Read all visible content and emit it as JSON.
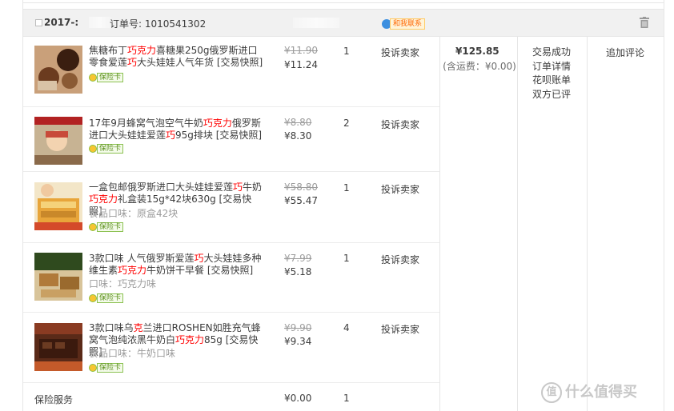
{
  "order": {
    "date": "2017-:",
    "order_no": "订单号: 1010541302",
    "contact_label": "和我联系",
    "total": "¥125.85",
    "freight": "(含运费：¥0.00)",
    "status_lines": [
      "交易成功",
      "订单详情",
      "花呗账单",
      "双方已评"
    ],
    "review_label": "追加评论"
  },
  "items": [
    {
      "title_a": "焦糖布丁",
      "title_hl1": "巧克力",
      "title_b": "喜糖果250g俄罗斯进口零食爱莲",
      "title_hl2": "巧",
      "title_c": "大头娃娃人气年货 [交易快照]",
      "option": "",
      "old_price": "¥11.90",
      "price": "¥11.24",
      "qty": "1",
      "action": "投诉卖家",
      "badge": "保险卡"
    },
    {
      "title_a": "17年9月蜂窝气泡空气牛奶",
      "title_hl1": "巧克力",
      "title_b": "俄罗斯进口大头娃娃爱莲",
      "title_hl2": "巧",
      "title_c": "95g排块 [交易快照]",
      "option": "",
      "old_price": "¥8.80",
      "price": "¥8.30",
      "qty": "2",
      "action": "投诉卖家",
      "badge": "保险卡"
    },
    {
      "title_a": "一盒包邮俄罗斯进口大头娃娃爱莲",
      "title_hl1": "巧",
      "title_b": "牛奶",
      "title_hl2": "巧克力",
      "title_c": "礼盒装15g*42块630g [交易快照]",
      "option": "食品口味：原盒42块",
      "old_price": "¥58.80",
      "price": "¥55.47",
      "qty": "1",
      "action": "投诉卖家",
      "badge": "保险卡"
    },
    {
      "title_a": "3款口味 人气俄罗斯爱莲",
      "title_hl1": "巧",
      "title_b": "大头娃娃多种维生素",
      "title_hl2": "巧克力",
      "title_c": "牛奶饼干早餐 [交易快照]",
      "option": "口味：巧克力味",
      "old_price": "¥7.99",
      "price": "¥5.18",
      "qty": "1",
      "action": "投诉卖家",
      "badge": "保险卡"
    },
    {
      "title_a": "3款口味乌",
      "title_hl1": "克",
      "title_b": "兰进口ROSHEN如胜充气蜂窝气泡纯浓黑牛奶白",
      "title_hl2": "巧克力",
      "title_c": "85g [交易快照]",
      "option": "食品口味：牛奶口味",
      "old_price": "¥9.90",
      "price": "¥9.34",
      "qty": "4",
      "action": "投诉卖家",
      "badge": "保险卡"
    }
  ],
  "insurance": {
    "label": "保险服务",
    "price": "¥0.00",
    "qty": "1"
  },
  "watermark": {
    "icon": "值",
    "text": "什么值得买"
  }
}
